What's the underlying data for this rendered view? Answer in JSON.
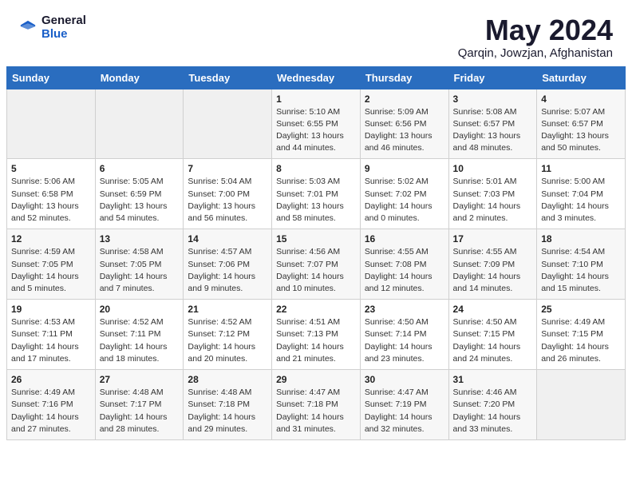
{
  "header": {
    "logo_general": "General",
    "logo_blue": "Blue",
    "month_title": "May 2024",
    "location": "Qarqin, Jowzjan, Afghanistan"
  },
  "weekdays": [
    "Sunday",
    "Monday",
    "Tuesday",
    "Wednesday",
    "Thursday",
    "Friday",
    "Saturday"
  ],
  "weeks": [
    [
      {
        "day": "",
        "info": ""
      },
      {
        "day": "",
        "info": ""
      },
      {
        "day": "",
        "info": ""
      },
      {
        "day": "1",
        "info": "Sunrise: 5:10 AM\nSunset: 6:55 PM\nDaylight: 13 hours\nand 44 minutes."
      },
      {
        "day": "2",
        "info": "Sunrise: 5:09 AM\nSunset: 6:56 PM\nDaylight: 13 hours\nand 46 minutes."
      },
      {
        "day": "3",
        "info": "Sunrise: 5:08 AM\nSunset: 6:57 PM\nDaylight: 13 hours\nand 48 minutes."
      },
      {
        "day": "4",
        "info": "Sunrise: 5:07 AM\nSunset: 6:57 PM\nDaylight: 13 hours\nand 50 minutes."
      }
    ],
    [
      {
        "day": "5",
        "info": "Sunrise: 5:06 AM\nSunset: 6:58 PM\nDaylight: 13 hours\nand 52 minutes."
      },
      {
        "day": "6",
        "info": "Sunrise: 5:05 AM\nSunset: 6:59 PM\nDaylight: 13 hours\nand 54 minutes."
      },
      {
        "day": "7",
        "info": "Sunrise: 5:04 AM\nSunset: 7:00 PM\nDaylight: 13 hours\nand 56 minutes."
      },
      {
        "day": "8",
        "info": "Sunrise: 5:03 AM\nSunset: 7:01 PM\nDaylight: 13 hours\nand 58 minutes."
      },
      {
        "day": "9",
        "info": "Sunrise: 5:02 AM\nSunset: 7:02 PM\nDaylight: 14 hours\nand 0 minutes."
      },
      {
        "day": "10",
        "info": "Sunrise: 5:01 AM\nSunset: 7:03 PM\nDaylight: 14 hours\nand 2 minutes."
      },
      {
        "day": "11",
        "info": "Sunrise: 5:00 AM\nSunset: 7:04 PM\nDaylight: 14 hours\nand 3 minutes."
      }
    ],
    [
      {
        "day": "12",
        "info": "Sunrise: 4:59 AM\nSunset: 7:05 PM\nDaylight: 14 hours\nand 5 minutes."
      },
      {
        "day": "13",
        "info": "Sunrise: 4:58 AM\nSunset: 7:05 PM\nDaylight: 14 hours\nand 7 minutes."
      },
      {
        "day": "14",
        "info": "Sunrise: 4:57 AM\nSunset: 7:06 PM\nDaylight: 14 hours\nand 9 minutes."
      },
      {
        "day": "15",
        "info": "Sunrise: 4:56 AM\nSunset: 7:07 PM\nDaylight: 14 hours\nand 10 minutes."
      },
      {
        "day": "16",
        "info": "Sunrise: 4:55 AM\nSunset: 7:08 PM\nDaylight: 14 hours\nand 12 minutes."
      },
      {
        "day": "17",
        "info": "Sunrise: 4:55 AM\nSunset: 7:09 PM\nDaylight: 14 hours\nand 14 minutes."
      },
      {
        "day": "18",
        "info": "Sunrise: 4:54 AM\nSunset: 7:10 PM\nDaylight: 14 hours\nand 15 minutes."
      }
    ],
    [
      {
        "day": "19",
        "info": "Sunrise: 4:53 AM\nSunset: 7:11 PM\nDaylight: 14 hours\nand 17 minutes."
      },
      {
        "day": "20",
        "info": "Sunrise: 4:52 AM\nSunset: 7:11 PM\nDaylight: 14 hours\nand 18 minutes."
      },
      {
        "day": "21",
        "info": "Sunrise: 4:52 AM\nSunset: 7:12 PM\nDaylight: 14 hours\nand 20 minutes."
      },
      {
        "day": "22",
        "info": "Sunrise: 4:51 AM\nSunset: 7:13 PM\nDaylight: 14 hours\nand 21 minutes."
      },
      {
        "day": "23",
        "info": "Sunrise: 4:50 AM\nSunset: 7:14 PM\nDaylight: 14 hours\nand 23 minutes."
      },
      {
        "day": "24",
        "info": "Sunrise: 4:50 AM\nSunset: 7:15 PM\nDaylight: 14 hours\nand 24 minutes."
      },
      {
        "day": "25",
        "info": "Sunrise: 4:49 AM\nSunset: 7:15 PM\nDaylight: 14 hours\nand 26 minutes."
      }
    ],
    [
      {
        "day": "26",
        "info": "Sunrise: 4:49 AM\nSunset: 7:16 PM\nDaylight: 14 hours\nand 27 minutes."
      },
      {
        "day": "27",
        "info": "Sunrise: 4:48 AM\nSunset: 7:17 PM\nDaylight: 14 hours\nand 28 minutes."
      },
      {
        "day": "28",
        "info": "Sunrise: 4:48 AM\nSunset: 7:18 PM\nDaylight: 14 hours\nand 29 minutes."
      },
      {
        "day": "29",
        "info": "Sunrise: 4:47 AM\nSunset: 7:18 PM\nDaylight: 14 hours\nand 31 minutes."
      },
      {
        "day": "30",
        "info": "Sunrise: 4:47 AM\nSunset: 7:19 PM\nDaylight: 14 hours\nand 32 minutes."
      },
      {
        "day": "31",
        "info": "Sunrise: 4:46 AM\nSunset: 7:20 PM\nDaylight: 14 hours\nand 33 minutes."
      },
      {
        "day": "",
        "info": ""
      }
    ]
  ]
}
